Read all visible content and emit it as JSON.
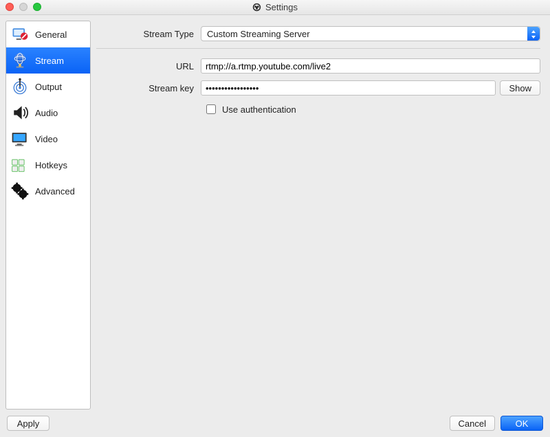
{
  "window": {
    "title": "Settings"
  },
  "sidebar": {
    "items": [
      {
        "label": "General",
        "icon": "general-icon"
      },
      {
        "label": "Stream",
        "icon": "stream-icon",
        "selected": true
      },
      {
        "label": "Output",
        "icon": "output-icon"
      },
      {
        "label": "Audio",
        "icon": "audio-icon"
      },
      {
        "label": "Video",
        "icon": "video-icon"
      },
      {
        "label": "Hotkeys",
        "icon": "hotkeys-icon"
      },
      {
        "label": "Advanced",
        "icon": "advanced-icon"
      }
    ]
  },
  "form": {
    "stream_type": {
      "label": "Stream Type",
      "value": "Custom Streaming Server"
    },
    "url": {
      "label": "URL",
      "value": "rtmp://a.rtmp.youtube.com/live2"
    },
    "stream_key": {
      "label": "Stream key",
      "value": "•••••••••••••••••",
      "show_button": "Show"
    },
    "use_auth": {
      "label": "Use authentication",
      "checked": false
    }
  },
  "footer": {
    "apply": "Apply",
    "cancel": "Cancel",
    "ok": "OK"
  }
}
